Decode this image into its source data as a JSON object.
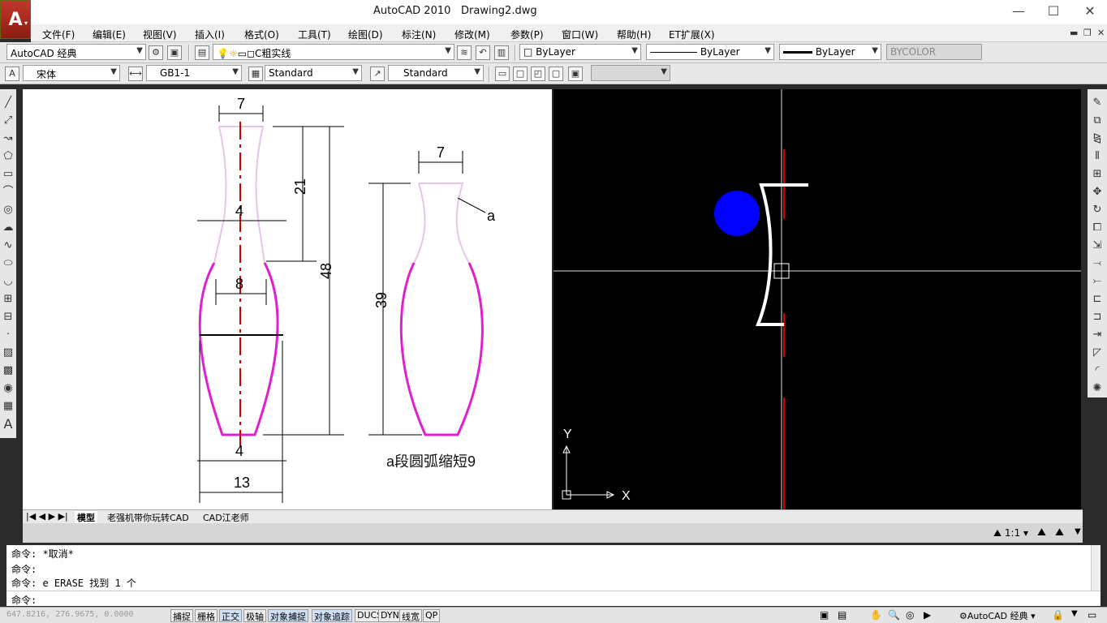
{
  "titlebar": {
    "app": "AutoCAD 2010",
    "document": "Drawing2.dwg"
  },
  "window_controls": {
    "minimize": "—",
    "maximize": "☐",
    "close": "✕"
  },
  "menus": [
    "文件(F)",
    "编辑(E)",
    "视图(V)",
    "插入(I)",
    "格式(O)",
    "工具(T)",
    "绘图(D)",
    "标注(N)",
    "修改(M)",
    "参数(P)",
    "窗口(W)",
    "帮助(H)",
    "ET扩展(X)"
  ],
  "toolbar1": {
    "workspace": "AutoCAD 经典",
    "layer": "C粗实线",
    "color": "ByLayer",
    "linetype": "ByLayer",
    "lineweight": "ByLayer",
    "plotstyle": "BYCOLOR"
  },
  "toolbar2": {
    "text_style": "宋体",
    "dim_style": "GB1-1",
    "table_style": "Standard",
    "multileader_style": "Standard"
  },
  "drawing": {
    "dims": {
      "top_width": "7",
      "height_upper": "21",
      "neck_width": "4",
      "belly_width": "8",
      "total_height": "48",
      "base_width": "4",
      "base_total": "13",
      "right_top": "7",
      "right_height": "39",
      "arc_label": "a"
    },
    "note": "a段圆弧缩短9",
    "accent": "#e020d0",
    "light": "#e8c8ec",
    "center": "#d00000"
  },
  "viewport": {
    "axis_x": "X",
    "axis_y": "Y",
    "circle_color": "#0000ff"
  },
  "tabs": [
    "模型",
    "老强机带你玩转CAD",
    "CAD江老师"
  ],
  "annotation_scale": "1:1",
  "command_history": [
    "命令: *取消*",
    "命令:",
    "命令: e ERASE 找到 1 个"
  ],
  "command_prompt": "命令:",
  "status": {
    "coords": "647.8216, 276.9675, 0.0000",
    "toggles": [
      "捕捉",
      "栅格",
      "正交",
      "极轴",
      "对象捕捉",
      "对象追踪",
      "DUCS",
      "DYN",
      "线宽",
      "QP"
    ],
    "workspace": "AutoCAD 经典"
  }
}
